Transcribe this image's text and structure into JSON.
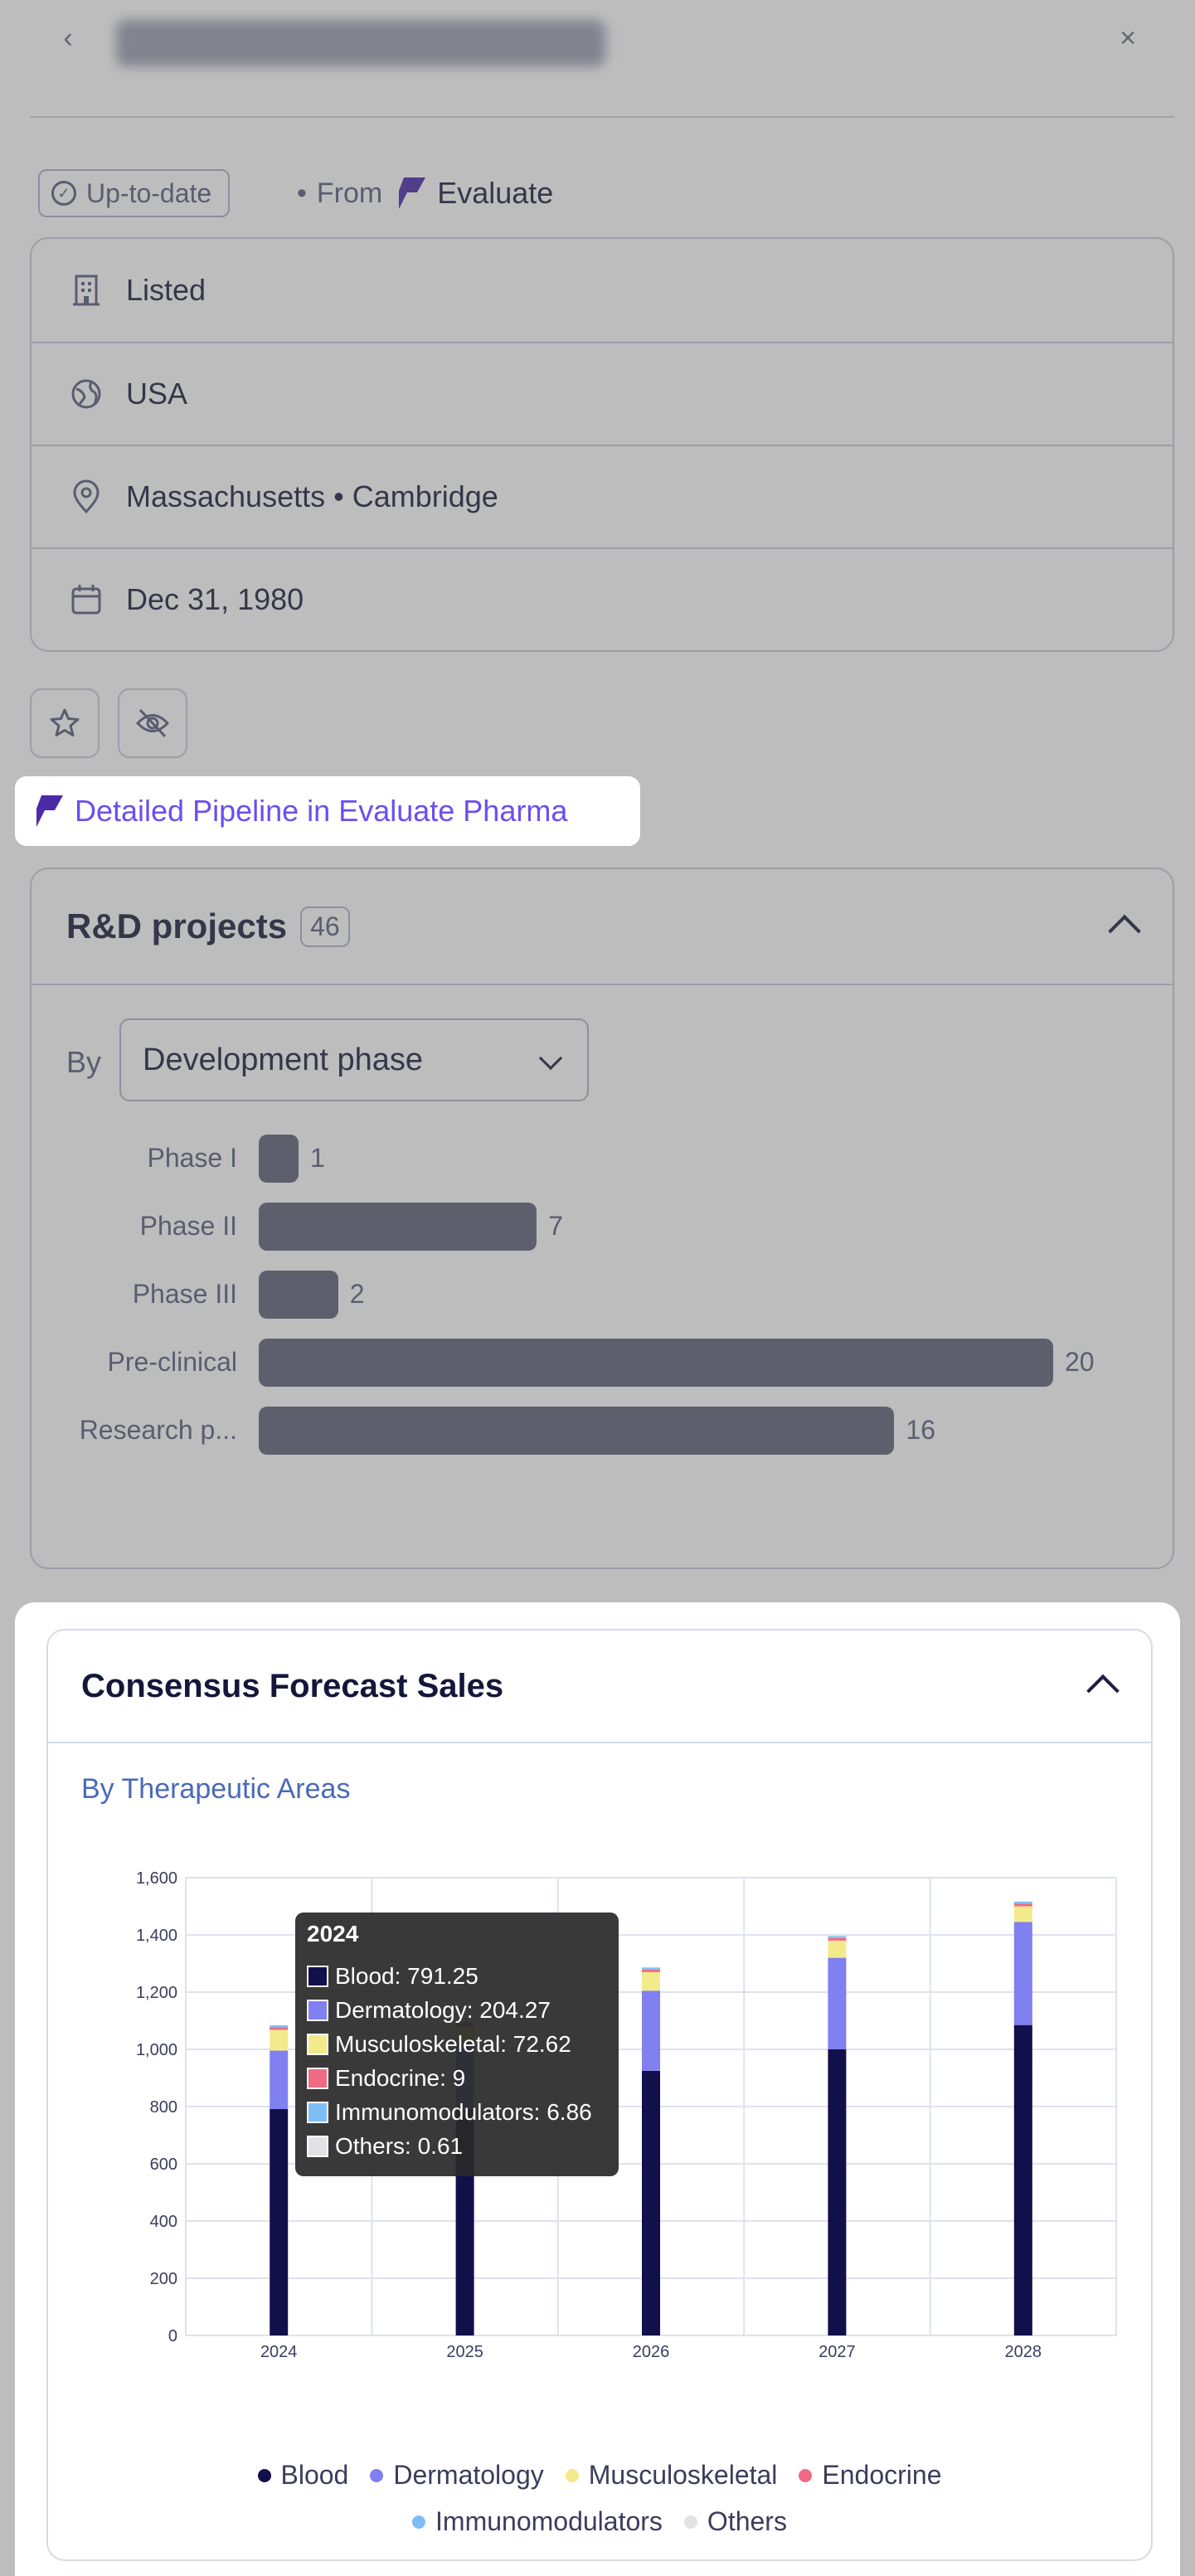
{
  "header": {
    "back_icon": "chevron-left-icon",
    "close_icon": "close-icon"
  },
  "status": {
    "badge": "Up-to-date",
    "separator": "•",
    "from_label": "From",
    "brand": "Evaluate"
  },
  "info": {
    "status": "Listed",
    "country": "USA",
    "location": "Massachusetts • Cambridge",
    "date": "Dec 31, 1980"
  },
  "actions": {
    "favorite_icon": "star-icon",
    "hide_icon": "eye-off-icon"
  },
  "pipeline_link": "Detailed Pipeline in Evaluate Pharma",
  "rd": {
    "title": "R&D projects",
    "count": "46",
    "by_label": "By",
    "group_by": "Development phase",
    "bars": [
      {
        "label": "Phase I",
        "value": 1
      },
      {
        "label": "Phase II",
        "value": 7
      },
      {
        "label": "Phase III",
        "value": 2
      },
      {
        "label": "Pre-clinical",
        "value": 20
      },
      {
        "label": "Research p...",
        "value": 16
      }
    ]
  },
  "forecast": {
    "title": "Consensus Forecast Sales",
    "subtitle": "By Therapeutic Areas",
    "tooltip": {
      "title": "2024",
      "rows": [
        "Blood: 791.25",
        "Dermatology: 204.27",
        "Musculoskeletal: 72.62",
        "Endocrine: 9",
        "Immunomodulators: 6.86",
        "Others: 0.61"
      ]
    }
  },
  "colors": {
    "Blood": "#12104a",
    "Dermatology": "#8080f0",
    "Musculoskeletal": "#f3ea8c",
    "Endocrine": "#f06a84",
    "Immunomodulators": "#7fbef5",
    "Others": "#e2e2e6"
  },
  "chart_data": {
    "type": "bar",
    "stacked": true,
    "categories": [
      "2024",
      "2025",
      "2026",
      "2027",
      "2028"
    ],
    "series": [
      {
        "name": "Blood",
        "values": [
          791.25,
          790,
          925,
          1000,
          1085
        ]
      },
      {
        "name": "Dermatology",
        "values": [
          204.27,
          230,
          280,
          320,
          360
        ]
      },
      {
        "name": "Musculoskeletal",
        "values": [
          72.62,
          60,
          65,
          60,
          55
        ]
      },
      {
        "name": "Endocrine",
        "values": [
          9,
          9,
          9,
          9,
          9
        ]
      },
      {
        "name": "Immunomodulators",
        "values": [
          6.86,
          7,
          7,
          7,
          7
        ]
      },
      {
        "name": "Others",
        "values": [
          0.61,
          1,
          1,
          1,
          1
        ]
      }
    ],
    "yticks": [
      0,
      200,
      400,
      600,
      800,
      1000,
      1200,
      1400,
      1600
    ],
    "ylim": [
      0,
      1600
    ],
    "grid": true,
    "legend": "bottom",
    "title": "",
    "xlabel": "",
    "ylabel": ""
  }
}
